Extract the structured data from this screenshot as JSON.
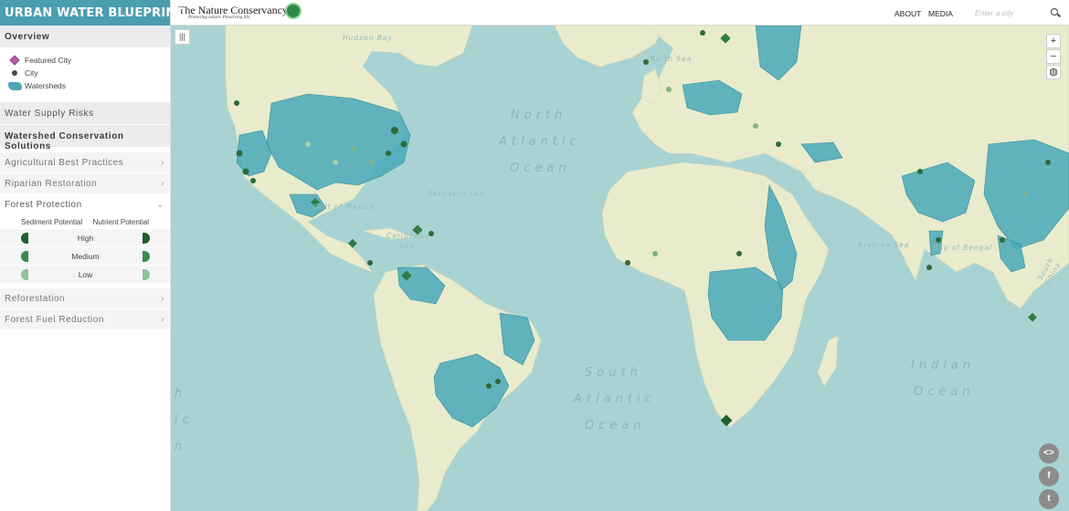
{
  "app": {
    "title": "URBAN WATER BLUEPRINT"
  },
  "sidebar": {
    "overview": "Overview",
    "legend": [
      {
        "label": "Featured City",
        "icon": "featured-city-diamond"
      },
      {
        "label": "City",
        "icon": "city-dot"
      },
      {
        "label": "Watersheds",
        "icon": "watershed-shape"
      }
    ],
    "water_supply_risks": "Water Supply Risks",
    "solutions_title": "Watershed Conservation Solutions",
    "solutions": [
      {
        "label": "Agricultural Best Practices"
      },
      {
        "label": "Riparian Restoration"
      },
      {
        "label": "Forest Protection"
      },
      {
        "label": "Reforestation"
      },
      {
        "label": "Forest Fuel Reduction"
      }
    ],
    "potential": {
      "sediment": "Sediment Potential",
      "nutrient": "Nutrient Potential",
      "levels": [
        "High",
        "Medium",
        "Low"
      ]
    }
  },
  "header": {
    "logo": "The Nature Conservancy",
    "tagline": "Protecting nature. Preserving life.",
    "about": "ABOUT",
    "media": "MEDIA",
    "search_placeholder": "Enter a city"
  },
  "map": {
    "labels": {
      "hudson_bay": "Hudson Bay",
      "north_sea": "North Sea",
      "north_atlantic_1": "North",
      "north_atlantic_2": "Atlantic",
      "north_atlantic_3": "Ocean",
      "sargasso": "Sargasso Sea",
      "gulf_mexico": "Gulf of Mexico",
      "caribbean_1": "Caribbean",
      "caribbean_2": "Sea",
      "arabian": "Arabian Sea",
      "bengal": "Bay of Bengal",
      "south_china": "South China",
      "south_atlantic_1": "South",
      "south_atlantic_2": "Atlantic",
      "south_atlantic_3": "Ocean",
      "indian_1": "Indian",
      "indian_2": "Ocean",
      "edge_1": "h",
      "edge_2": "ic",
      "edge_3": "n"
    },
    "controls": {
      "zoom_in": "+",
      "zoom_out": "−"
    }
  },
  "colors": {
    "brand": "#4b9db0",
    "ocean": "#a9d3d3",
    "land": "#e8eccd",
    "watershed": "#48a8b8",
    "featured_city": "#b55fa8",
    "high": "#1f5e2e",
    "medium": "#3a8a4c",
    "low": "#8fc49a"
  }
}
